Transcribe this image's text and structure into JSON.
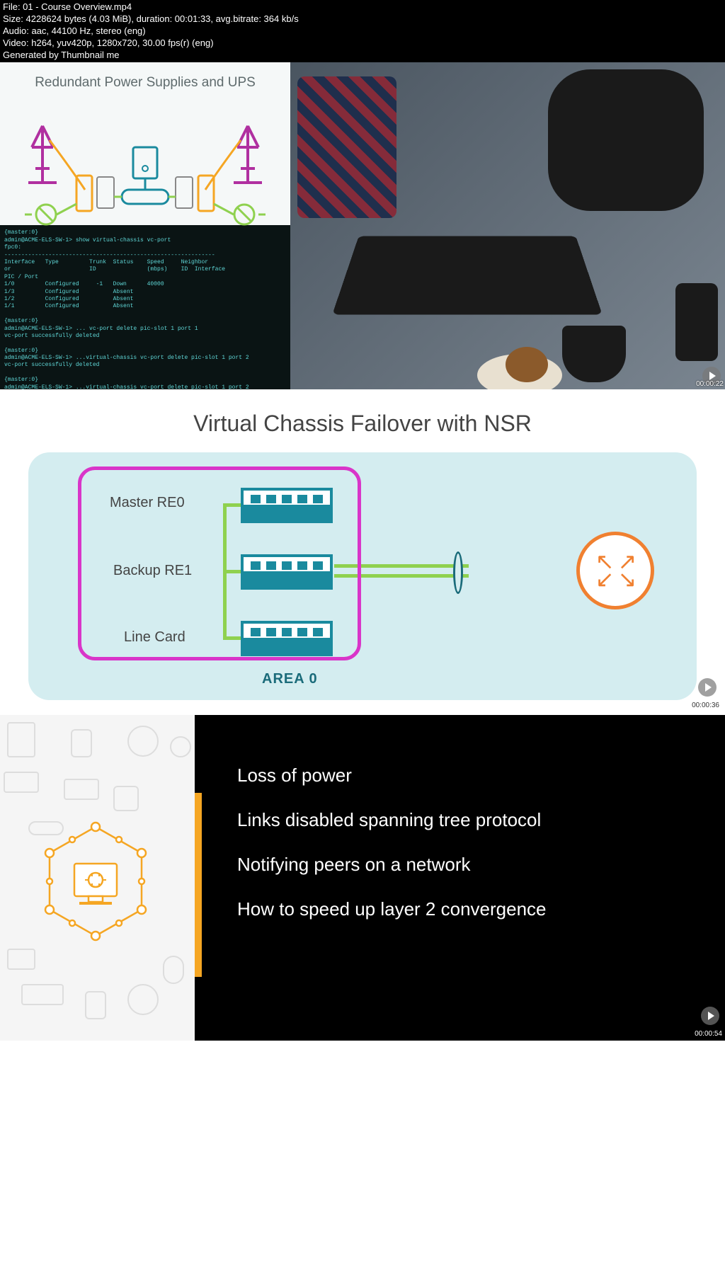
{
  "meta": {
    "file": "File: 01 - Course Overview.mp4",
    "size": "Size: 4228624 bytes (4.03 MiB), duration: 00:01:33, avg.bitrate: 364 kb/s",
    "audio": "Audio: aac, 44100 Hz, stereo (eng)",
    "video": "Video: h264, yuv420p, 1280x720, 30.00 fps(r) (eng)",
    "generated": "Generated by Thumbnail me"
  },
  "panel1": {
    "title": "Redundant Power Supplies and UPS",
    "terminal": "{master:0}\nadmin@ACME-ELS-SW-1> show virtual-chassis vc-port\nfpc0:\n--------------------------------------------------------------\nInterface   Type         Trunk  Status    Speed     Neighbor\nor                       ID               (mbps)    ID  Interface\nPIC / Port\n1/0         Configured     -1   Down      40000\n1/3         Configured          Absent\n1/2         Configured          Absent\n1/1         Configured          Absent\n\n{master:0}\nadmin@ACME-ELS-SW-1> ... vc-port delete pic-slot 1 port 1\nvc-port successfully deleted\n\n{master:0}\nadmin@ACME-ELS-SW-1> ...virtual-chassis vc-port delete pic-slot 1 port 2\nvc-port successfully deleted\n\n{master:0}\nadmin@ACME-ELS-SW-1> ...virtual-chassis vc-port delete pic-slot 1 port 2 ",
    "timestamp": "00:00:22"
  },
  "panel2": {
    "title": "Virtual Chassis Failover with NSR",
    "labels": {
      "master": "Master RE0",
      "backup": "Backup RE1",
      "linecard": "Line Card",
      "area": "AREA 0"
    },
    "timestamp": "00:00:36"
  },
  "panel3": {
    "bullets": {
      "b1": "Loss of power",
      "b2": "Links disabled spanning tree protocol",
      "b3": "Notifying peers on a network",
      "b4": "How to speed up layer 2 convergence"
    },
    "timestamp": "00:00:54"
  }
}
